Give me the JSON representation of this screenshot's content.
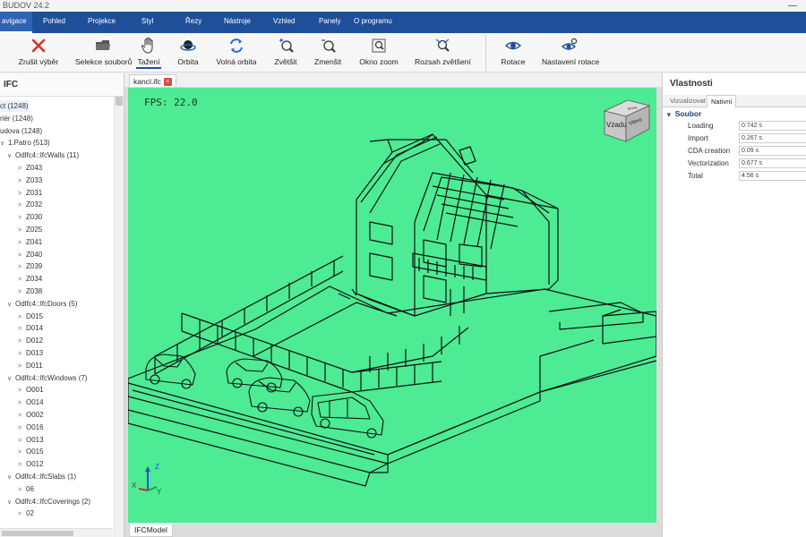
{
  "app": {
    "title": "BUDOV 24.2"
  },
  "menu": [
    "avigace",
    "Pohled",
    "Projekce",
    "Styl",
    "Řezy",
    "Nástroje",
    "Vzhled",
    "Panely",
    "O programu"
  ],
  "toolbar": {
    "cancel_selection": "Zrušit výběr",
    "file_selection": "Selekce souborů",
    "drag": "Tažení",
    "orbit": "Orbita",
    "free_orbit": "Volná orbita",
    "zoom_in": "Zvětšit",
    "zoom_out": "Zmenšit",
    "zoom_window": "Okno zoom",
    "zoom_extents": "Rozsah zvětšení",
    "rotate": "Rotace",
    "rotate_settings": "Nastavení rotace"
  },
  "left_panel": {
    "title": "IFC",
    "tree": [
      {
        "label": "ct (1248)",
        "indent": 0,
        "chev": ""
      },
      {
        "label": "riér (1248)",
        "indent": 0,
        "chev": ""
      },
      {
        "label": "udova (1248)",
        "indent": 0,
        "chev": ""
      },
      {
        "label": "1.Patro (513)",
        "indent": 1,
        "chev": "∨"
      },
      {
        "label": "Odlfc4::IfcWalls (11)",
        "indent": 2,
        "chev": "∨"
      },
      {
        "label": "Z043",
        "indent": 3,
        "chev": ">"
      },
      {
        "label": "Z033",
        "indent": 3,
        "chev": ">"
      },
      {
        "label": "Z031",
        "indent": 3,
        "chev": ">"
      },
      {
        "label": "Z032",
        "indent": 3,
        "chev": ">"
      },
      {
        "label": "Z030",
        "indent": 3,
        "chev": ">"
      },
      {
        "label": "Z025",
        "indent": 3,
        "chev": ">"
      },
      {
        "label": "Z041",
        "indent": 3,
        "chev": ">"
      },
      {
        "label": "Z040",
        "indent": 3,
        "chev": ">"
      },
      {
        "label": "Z039",
        "indent": 3,
        "chev": ">"
      },
      {
        "label": "Z034",
        "indent": 3,
        "chev": ">"
      },
      {
        "label": "Z038",
        "indent": 3,
        "chev": ">"
      },
      {
        "label": "Odlfc4::IfcDoors (5)",
        "indent": 2,
        "chev": "∨"
      },
      {
        "label": "D015",
        "indent": 3,
        "chev": ">"
      },
      {
        "label": "D014",
        "indent": 3,
        "chev": ">"
      },
      {
        "label": "D012",
        "indent": 3,
        "chev": ">"
      },
      {
        "label": "D013",
        "indent": 3,
        "chev": ">"
      },
      {
        "label": "D011",
        "indent": 3,
        "chev": ">"
      },
      {
        "label": "Odlfc4::IfcWindows (7)",
        "indent": 2,
        "chev": "∨"
      },
      {
        "label": "O001",
        "indent": 3,
        "chev": ">"
      },
      {
        "label": "O014",
        "indent": 3,
        "chev": ">"
      },
      {
        "label": "O002",
        "indent": 3,
        "chev": ">"
      },
      {
        "label": "O016",
        "indent": 3,
        "chev": ">"
      },
      {
        "label": "O013",
        "indent": 3,
        "chev": ">"
      },
      {
        "label": "O015",
        "indent": 3,
        "chev": ">"
      },
      {
        "label": "O012",
        "indent": 3,
        "chev": ">"
      },
      {
        "label": "Odlfc4::IfcSlabs (1)",
        "indent": 2,
        "chev": "∨"
      },
      {
        "label": "06",
        "indent": 3,
        "chev": ">"
      },
      {
        "label": "Odlfc4::IfcCoverings (2)",
        "indent": 2,
        "chev": "∨"
      },
      {
        "label": "02",
        "indent": 3,
        "chev": ">"
      }
    ]
  },
  "document": {
    "tab": "kancl.ifc",
    "fps": "FPS: 22.0",
    "bottom_tab": "IFCModel"
  },
  "navcube": {
    "front": "Vzadu",
    "side": "Vlevo",
    "top": "Shora"
  },
  "axes": {
    "x": "X",
    "y": "Y",
    "z": "Z"
  },
  "right_panel": {
    "title": "Vlastnosti",
    "tabs": [
      "Vizualizovat",
      "Nativní"
    ],
    "section": "Soubor",
    "props": [
      {
        "key": "Loading",
        "value": "0.742 s"
      },
      {
        "key": "Import",
        "value": "0.267 s"
      },
      {
        "key": "CDA creation",
        "value": "0.09 s"
      },
      {
        "key": "Vectorization",
        "value": "0.677 s"
      },
      {
        "key": "Total",
        "value": "4.56 s"
      }
    ]
  },
  "colors": {
    "viewport_bg": "#4deb93",
    "menubar": "#1f4f99",
    "close_red": "#e04b3a",
    "accent": "#1f4f99"
  }
}
